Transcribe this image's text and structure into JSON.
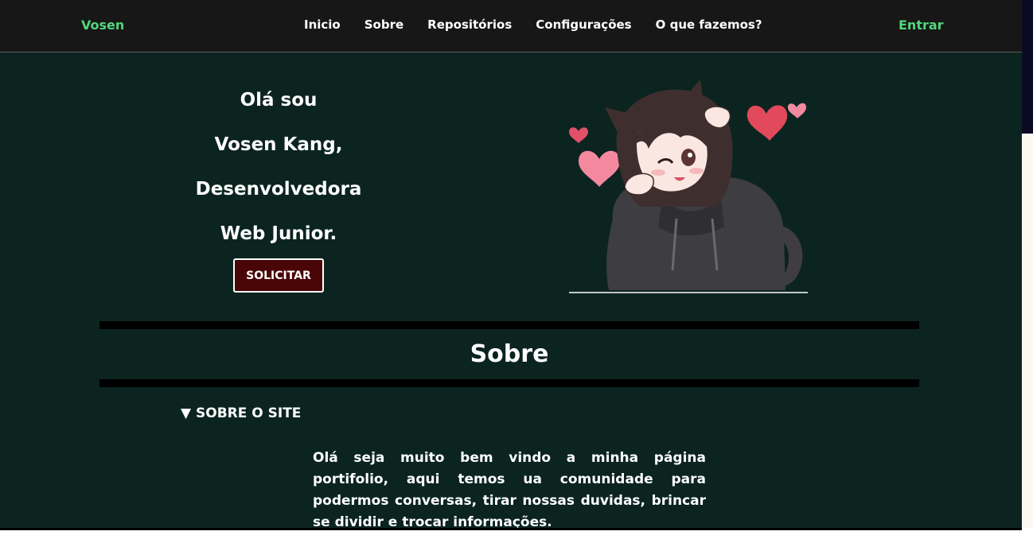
{
  "navbar": {
    "brand": "Vosen",
    "links": [
      "Inicio",
      "Sobre",
      "Repositórios",
      "Configurações",
      "O que fazemos?"
    ],
    "login": "Entrar"
  },
  "hero": {
    "lines": [
      "Olá sou",
      "Vosen Kang,",
      "Desenvolvedora",
      "Web Junior."
    ],
    "button": "SOLICITAR"
  },
  "about": {
    "title": "Sobre",
    "summary": "▼ SOBRE O SITE",
    "text": "Olá seja muito bem vindo a minha página portifolio, aqui temos ua comunidade para podermos conversas, tirar nossas duvidas, brincar se dividir e trocar informações."
  },
  "colors": {
    "background": "#0b241f",
    "navbar": "#171717",
    "accent": "#52d57a",
    "button": "#4a0507"
  }
}
